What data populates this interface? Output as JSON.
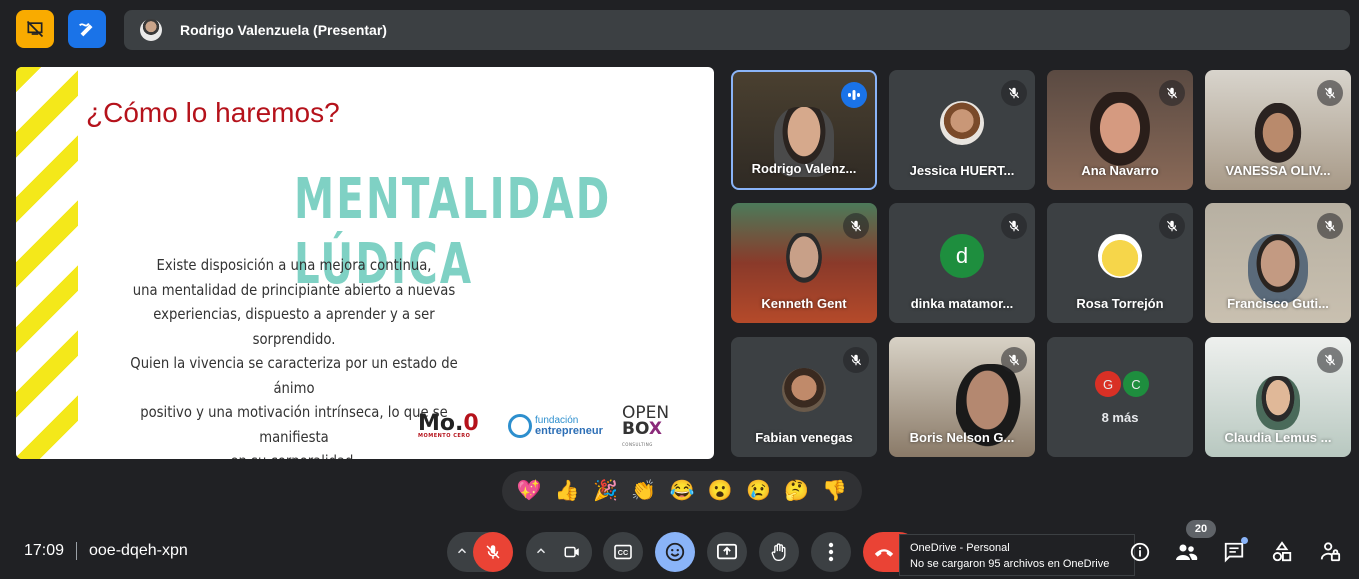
{
  "header": {
    "presenter_label": "Rodrigo Valenzuela (Presentar)"
  },
  "slide": {
    "title": "¿Cómo lo haremos?",
    "heading": "MENTALIDAD LÚDICA",
    "body_lines": [
      "Existe disposición a una mejora continua,",
      "una mentalidad de principiante abierto a nuevas",
      "experiencias, dispuesto a aprender y a ser sorprendido.",
      "Quien la vivencia se caracteriza por un estado de ánimo",
      "positivo y una motivación intrínseca, lo que se manifiesta",
      "en su corporalidad."
    ],
    "logo_mo": "Mo.",
    "logo_mo_o": "0",
    "logo_mo_sub": "MOMENTO CERO",
    "logo_fund_1": "fundación",
    "logo_fund_2": "entrepreneur",
    "logo_open_1": "OPEN",
    "logo_open_2": "BO",
    "logo_open_x": "X",
    "logo_open_sub": "CONSULTING"
  },
  "participants": [
    {
      "name": "Rodrigo Valenz...",
      "speaking": true
    },
    {
      "name": "Jessica HUERT...",
      "muted": true
    },
    {
      "name": "Ana Navarro",
      "muted": true
    },
    {
      "name": "VANESSA OLIV...",
      "muted": true
    },
    {
      "name": "Kenneth Gent",
      "muted": true
    },
    {
      "name": "dinka matamor...",
      "muted": true,
      "initial": "d"
    },
    {
      "name": "Rosa Torrejón",
      "muted": true
    },
    {
      "name": "Francisco Guti...",
      "muted": true
    },
    {
      "name": "Fabian venegas",
      "muted": true
    },
    {
      "name": "Boris Nelson G...",
      "muted": true
    },
    {
      "name": "8 más",
      "initials": [
        "G",
        "C"
      ]
    },
    {
      "name": "Claudia Lemus ...",
      "muted": true
    }
  ],
  "reactions": [
    "💖",
    "👍",
    "🎉",
    "👏",
    "😂",
    "😮",
    "😢",
    "🤔",
    "👎"
  ],
  "footer": {
    "time": "17:09",
    "meeting_code": "ooe-dqeh-xpn",
    "participant_count": "20"
  },
  "toast": {
    "title": "OneDrive - Personal",
    "message": "No se cargaron 95 archivos en OneDrive"
  },
  "colors": {
    "background": "#202124",
    "tile": "#3c4043",
    "mic_off_red": "#ea4335",
    "accent_blue": "#8ab4f8",
    "stripe_yellow": "#f4e81a",
    "heading_teal": "#7fd1c4",
    "title_red": "#b5121b"
  }
}
